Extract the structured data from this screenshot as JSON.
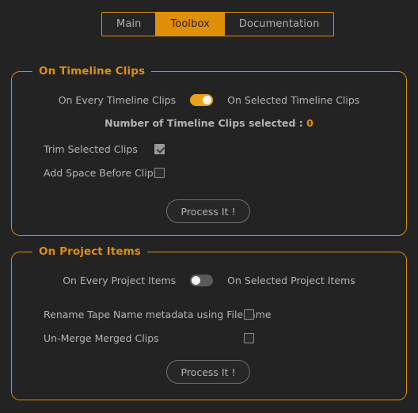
{
  "theme": {
    "background": "#232323",
    "accent": "#df8f08",
    "toggle_on": "#e8a317",
    "text": "#b4b4b4"
  },
  "tabs": [
    {
      "label": "Main",
      "active": false
    },
    {
      "label": "Toolbox",
      "active": true
    },
    {
      "label": "Documentation",
      "active": false
    }
  ],
  "timeline_section": {
    "legend": "On Timeline Clips",
    "toggle": {
      "left_label": "On Every Timeline Clips",
      "right_label": "On Selected Timeline Clips",
      "state": "on"
    },
    "count_label": "Number of Timeline Clips selected :",
    "count_value": "0",
    "checkboxes": [
      {
        "label": "Trim Selected Clips",
        "checked": true
      },
      {
        "label": "Add Space Before Clips",
        "checked": false
      }
    ],
    "process_button": "Process It !"
  },
  "project_section": {
    "legend": "On Project Items",
    "toggle": {
      "left_label": "On Every Project Items",
      "right_label": "On Selected Project Items",
      "state": "off"
    },
    "checkboxes": [
      {
        "label": "Rename Tape Name metadata using Filename",
        "checked": false
      },
      {
        "label": "Un-Merge Merged Clips",
        "checked": false
      }
    ],
    "process_button": "Process It !"
  }
}
